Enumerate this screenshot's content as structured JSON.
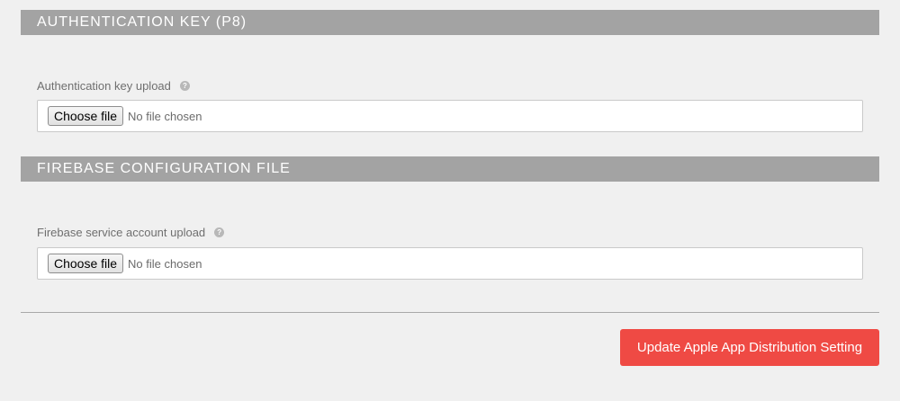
{
  "auth_section": {
    "title": "AUTHENTICATION KEY (P8)",
    "field_label": "Authentication key upload",
    "help_glyph": "?",
    "choose_label": "Choose file",
    "file_status": "No file chosen"
  },
  "firebase_section": {
    "title": "FIREBASE CONFIGURATION FILE",
    "field_label": "Firebase service account upload",
    "help_glyph": "?",
    "choose_label": "Choose file",
    "file_status": "No file chosen"
  },
  "footer": {
    "submit_label": "Update Apple App Distribution Setting"
  },
  "colors": {
    "section_header_bg": "#a3a3a3",
    "accent": "#ef4a44",
    "page_bg": "#f0f0f0"
  },
  "icons": {
    "help": "help-icon"
  }
}
